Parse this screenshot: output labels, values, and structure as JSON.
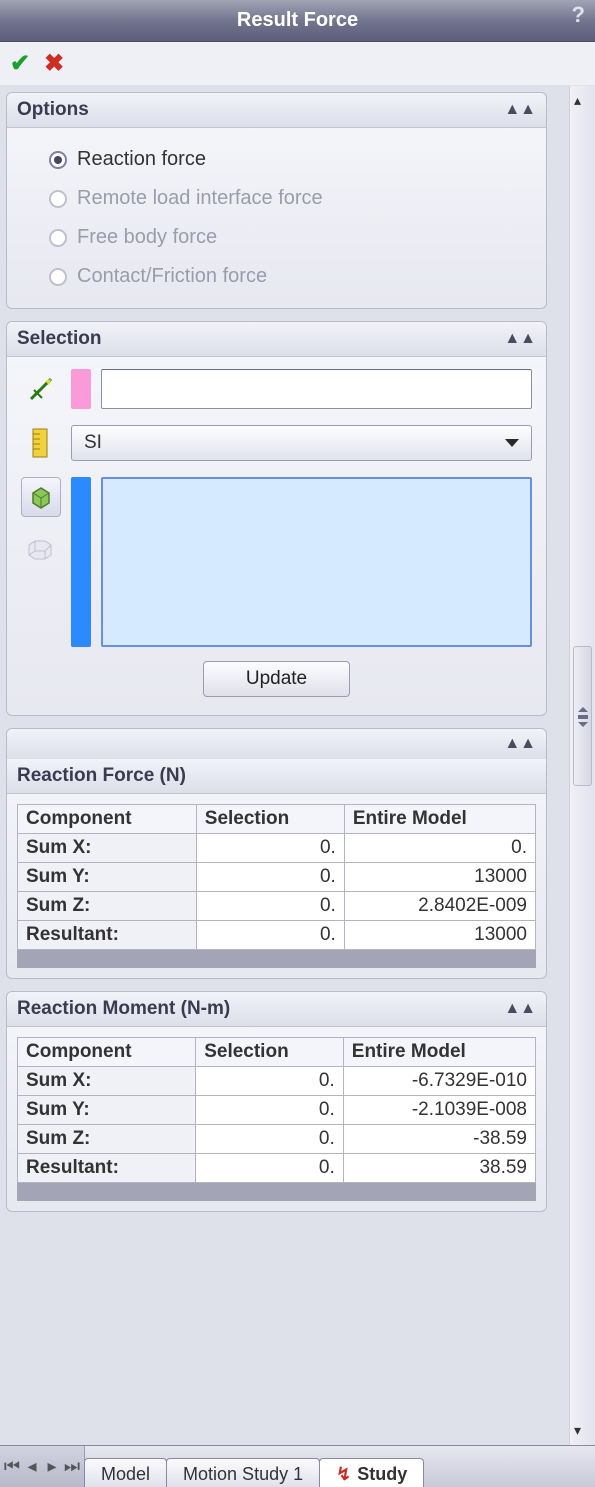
{
  "title": "Result Force",
  "options": {
    "header": "Options",
    "items": [
      {
        "label": "Reaction force",
        "selected": true,
        "disabled": false
      },
      {
        "label": "Remote load interface force",
        "selected": false,
        "disabled": true
      },
      {
        "label": "Free body force",
        "selected": false,
        "disabled": true
      },
      {
        "label": "Contact/Friction force",
        "selected": false,
        "disabled": true
      }
    ]
  },
  "selection": {
    "header": "Selection",
    "units_value": "SI",
    "update_label": "Update"
  },
  "force_table": {
    "header": "Reaction Force (N)",
    "columns": [
      "Component",
      "Selection",
      "Entire Model"
    ],
    "rows": [
      {
        "label": "Sum X:",
        "selection": "0.",
        "entire": "0."
      },
      {
        "label": "Sum Y:",
        "selection": "0.",
        "entire": "13000"
      },
      {
        "label": "Sum Z:",
        "selection": "0.",
        "entire": "2.8402E-009"
      },
      {
        "label": "Resultant:",
        "selection": "0.",
        "entire": "13000"
      }
    ]
  },
  "moment_table": {
    "header": "Reaction Moment (N-m)",
    "columns": [
      "Component",
      "Selection",
      "Entire Model"
    ],
    "rows": [
      {
        "label": "Sum X:",
        "selection": "0.",
        "entire": "-6.7329E-010"
      },
      {
        "label": "Sum Y:",
        "selection": "0.",
        "entire": "-2.1039E-008"
      },
      {
        "label": "Sum Z:",
        "selection": "0.",
        "entire": "-38.59"
      },
      {
        "label": "Resultant:",
        "selection": "0.",
        "entire": "38.59"
      }
    ]
  },
  "tabs": {
    "model": "Model",
    "motion": "Motion Study 1",
    "study": "Study"
  }
}
